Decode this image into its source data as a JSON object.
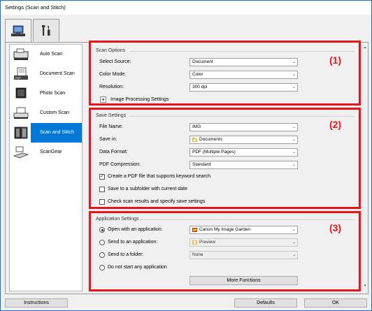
{
  "window": {
    "title": "Settings (Scan and Stitch)"
  },
  "tabs": [
    {
      "name": "scan-from-computer",
      "icon": "computer-scan-icon"
    },
    {
      "name": "general-settings",
      "icon": "tools-icon"
    }
  ],
  "sidebar": {
    "items": [
      {
        "label": "Auto Scan",
        "icon": "auto-scan-icon"
      },
      {
        "label": "Document Scan",
        "icon": "document-scan-icon"
      },
      {
        "label": "Photo Scan",
        "icon": "photo-scan-icon"
      },
      {
        "label": "Custom Scan",
        "icon": "custom-scan-icon"
      },
      {
        "label": "Scan and Stitch",
        "icon": "scan-stitch-icon",
        "selected": true
      },
      {
        "label": "ScanGear",
        "icon": "scangear-icon"
      }
    ]
  },
  "scan_options": {
    "title": "Scan Options",
    "number": "(1)",
    "select_source_label": "Select Source:",
    "select_source_value": "Document",
    "color_mode_label": "Color Mode:",
    "color_mode_value": "Color",
    "resolution_label": "Resolution:",
    "resolution_value": "300 dpi",
    "image_processing_label": "Image Processing Settings",
    "expand_symbol": "+"
  },
  "save_settings": {
    "title": "Save Settings",
    "number": "(2)",
    "file_name_label": "File Name:",
    "file_name_value": "IMG",
    "save_in_label": "Save in:",
    "save_in_value": "Documents",
    "data_format_label": "Data Format:",
    "data_format_value": "PDF (Multiple Pages)",
    "pdf_compression_label": "PDF Compression:",
    "pdf_compression_value": "Standard",
    "keyword_search_label": "Create a PDF file that supports keyword search",
    "keyword_search_checked": true,
    "subfolder_label": "Save to a subfolder with current date",
    "subfolder_checked": false,
    "check_results_label": "Check scan results and specify save settings",
    "check_results_checked": false,
    "check_mark": "✓"
  },
  "application_settings": {
    "title": "Application Settings",
    "number": "(3)",
    "open_app_label": "Open with an application:",
    "open_app_value": "Canon My Image Garden",
    "send_app_label": "Send to an application:",
    "send_app_value": "Preview",
    "send_folder_label": "Send to a folder:",
    "send_folder_value": "None",
    "do_not_start_label": "Do not start any application",
    "more_functions_label": "More Functions",
    "selected_option": "open_app"
  },
  "footer": {
    "instructions_label": "Instructions",
    "defaults_label": "Defaults",
    "ok_label": "OK"
  },
  "colors": {
    "highlight": "#e8141c",
    "selection": "#0078d7",
    "window_border": "#1e6fc2"
  },
  "glyphs": {
    "chevron": "⌄",
    "scroll_up": "▲",
    "scroll_down": "▼"
  }
}
